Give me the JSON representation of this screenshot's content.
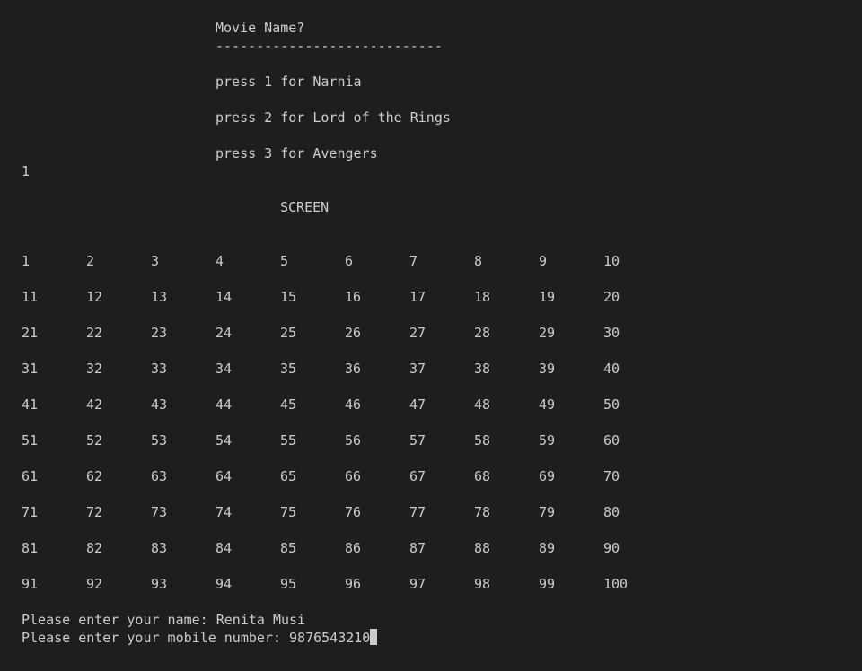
{
  "menu": {
    "title": "Movie Name?",
    "divider": "----------------------------",
    "options": [
      "press 1 for Narnia",
      "press 2 for Lord of the Rings",
      "press 3 for Avengers"
    ]
  },
  "user_choice": "1",
  "screen_label": "SCREEN",
  "seats": [
    [
      "1",
      "2",
      "3",
      "4",
      "5",
      "6",
      "7",
      "8",
      "9",
      "10"
    ],
    [
      "11",
      "12",
      "13",
      "14",
      "15",
      "16",
      "17",
      "18",
      "19",
      "20"
    ],
    [
      "21",
      "22",
      "23",
      "24",
      "25",
      "26",
      "27",
      "28",
      "29",
      "30"
    ],
    [
      "31",
      "32",
      "33",
      "34",
      "35",
      "36",
      "37",
      "38",
      "39",
      "40"
    ],
    [
      "41",
      "42",
      "43",
      "44",
      "45",
      "46",
      "47",
      "48",
      "49",
      "50"
    ],
    [
      "51",
      "52",
      "53",
      "54",
      "55",
      "56",
      "57",
      "58",
      "59",
      "60"
    ],
    [
      "61",
      "62",
      "63",
      "64",
      "65",
      "66",
      "67",
      "68",
      "69",
      "70"
    ],
    [
      "71",
      "72",
      "73",
      "74",
      "75",
      "76",
      "77",
      "78",
      "79",
      "80"
    ],
    [
      "81",
      "82",
      "83",
      "84",
      "85",
      "86",
      "87",
      "88",
      "89",
      "90"
    ],
    [
      "91",
      "92",
      "93",
      "94",
      "95",
      "96",
      "97",
      "98",
      "99",
      "100"
    ]
  ],
  "prompts": {
    "name_prompt": "Please enter your name: ",
    "name_value": "Renita Musi",
    "mobile_prompt": "Please enter your mobile number: ",
    "mobile_value": "9876543210"
  }
}
